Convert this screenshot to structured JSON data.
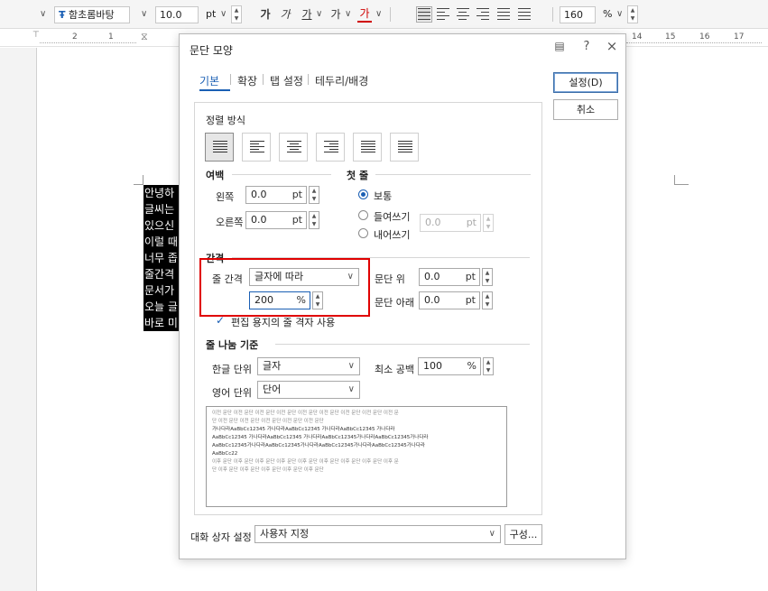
{
  "toolbar": {
    "font_icon": "Ŧ",
    "font_name": "함초롬바탕",
    "font_size": "10.0",
    "font_unit": "pt",
    "style_buttons": [
      "가",
      "가",
      "가",
      "가",
      "가"
    ],
    "zoom_value": "160",
    "zoom_unit": "%"
  },
  "ruler": {
    "numbers": [
      "2",
      "1",
      "14",
      "15",
      "16",
      "17"
    ]
  },
  "document": {
    "lines": [
      "안녕하",
      "글씨는",
      "있으신",
      "이럴 때",
      "너무 좁",
      "줄간격",
      "문서가",
      "오늘 글",
      "바로 미"
    ]
  },
  "dialog": {
    "title": "문단 모양",
    "controls": {
      "help": "?",
      "close": "×"
    },
    "tabs": [
      "기본",
      "확장",
      "탭 설정",
      "테두리/배경"
    ],
    "buttons": {
      "ok": "설정(D)",
      "cancel": "취소",
      "compose": "구성..."
    },
    "align": {
      "label": "정렬 방식"
    },
    "margin": {
      "label": "여백",
      "left_label": "왼쪽",
      "left_value": "0.0",
      "right_label": "오른쪽",
      "right_value": "0.0",
      "unit": "pt"
    },
    "first_line": {
      "label": "첫 줄",
      "options": [
        "보통",
        "들여쓰기",
        "내어쓰기"
      ],
      "value": "0.0",
      "unit": "pt"
    },
    "spacing": {
      "label": "간격",
      "line_label": "줄 간격",
      "line_type": "글자에 따라",
      "line_value": "200",
      "line_unit": "%",
      "above_label": "문단 위",
      "above_value": "0.0",
      "below_label": "문단 아래",
      "below_value": "0.0",
      "unit": "pt",
      "grid_check": "편집 용지의 줄 격자 사용"
    },
    "line_break": {
      "label": "줄 나눔 기준",
      "hangul_label": "한글 단위",
      "hangul_value": "글자",
      "english_label": "영어 단위",
      "english_value": "단어",
      "min_space_label": "최소 공백",
      "min_space_value": "100",
      "min_space_unit": "%"
    },
    "preview_lines": [
      "이전 문단 이전 문단 이전 문단 이전 문단 이전 문단 이전 문단 이전 문단 이전 문단 이전 문",
      "단 이전 문단 이전 문단 이전 문단 이전 문단 이전 문단",
      "가나다라AaBbCc12345      가나다라AaBbCc12345      가나다라AaBbCc12345      가나다라",
      "AaBbCc12345  가나다라AaBbCc12345  가나다라AaBbCc12345가나다라AaBbCc12345가나다라",
      "AaBbCc12345가나다라AaBbCc12345가나다라AaBbCc12345가나다라AaBbCc12345가나다라",
      "AaBbCc22",
      "이후 문단 이후 문단 이후 문단 이후 문단 이후 문단 이후 문단 이후 문단 이후 문단 이후 문",
      "단 이후 문단 이후 문단 이후 문단 이후 문단 이후 문단"
    ],
    "dialog_setting": {
      "label": "대화 상자 설정",
      "value": "사용자 지정"
    }
  },
  "colors": {
    "accent": "#1a5fb4",
    "highlight": "#e00000",
    "font_red": "#d00000"
  }
}
